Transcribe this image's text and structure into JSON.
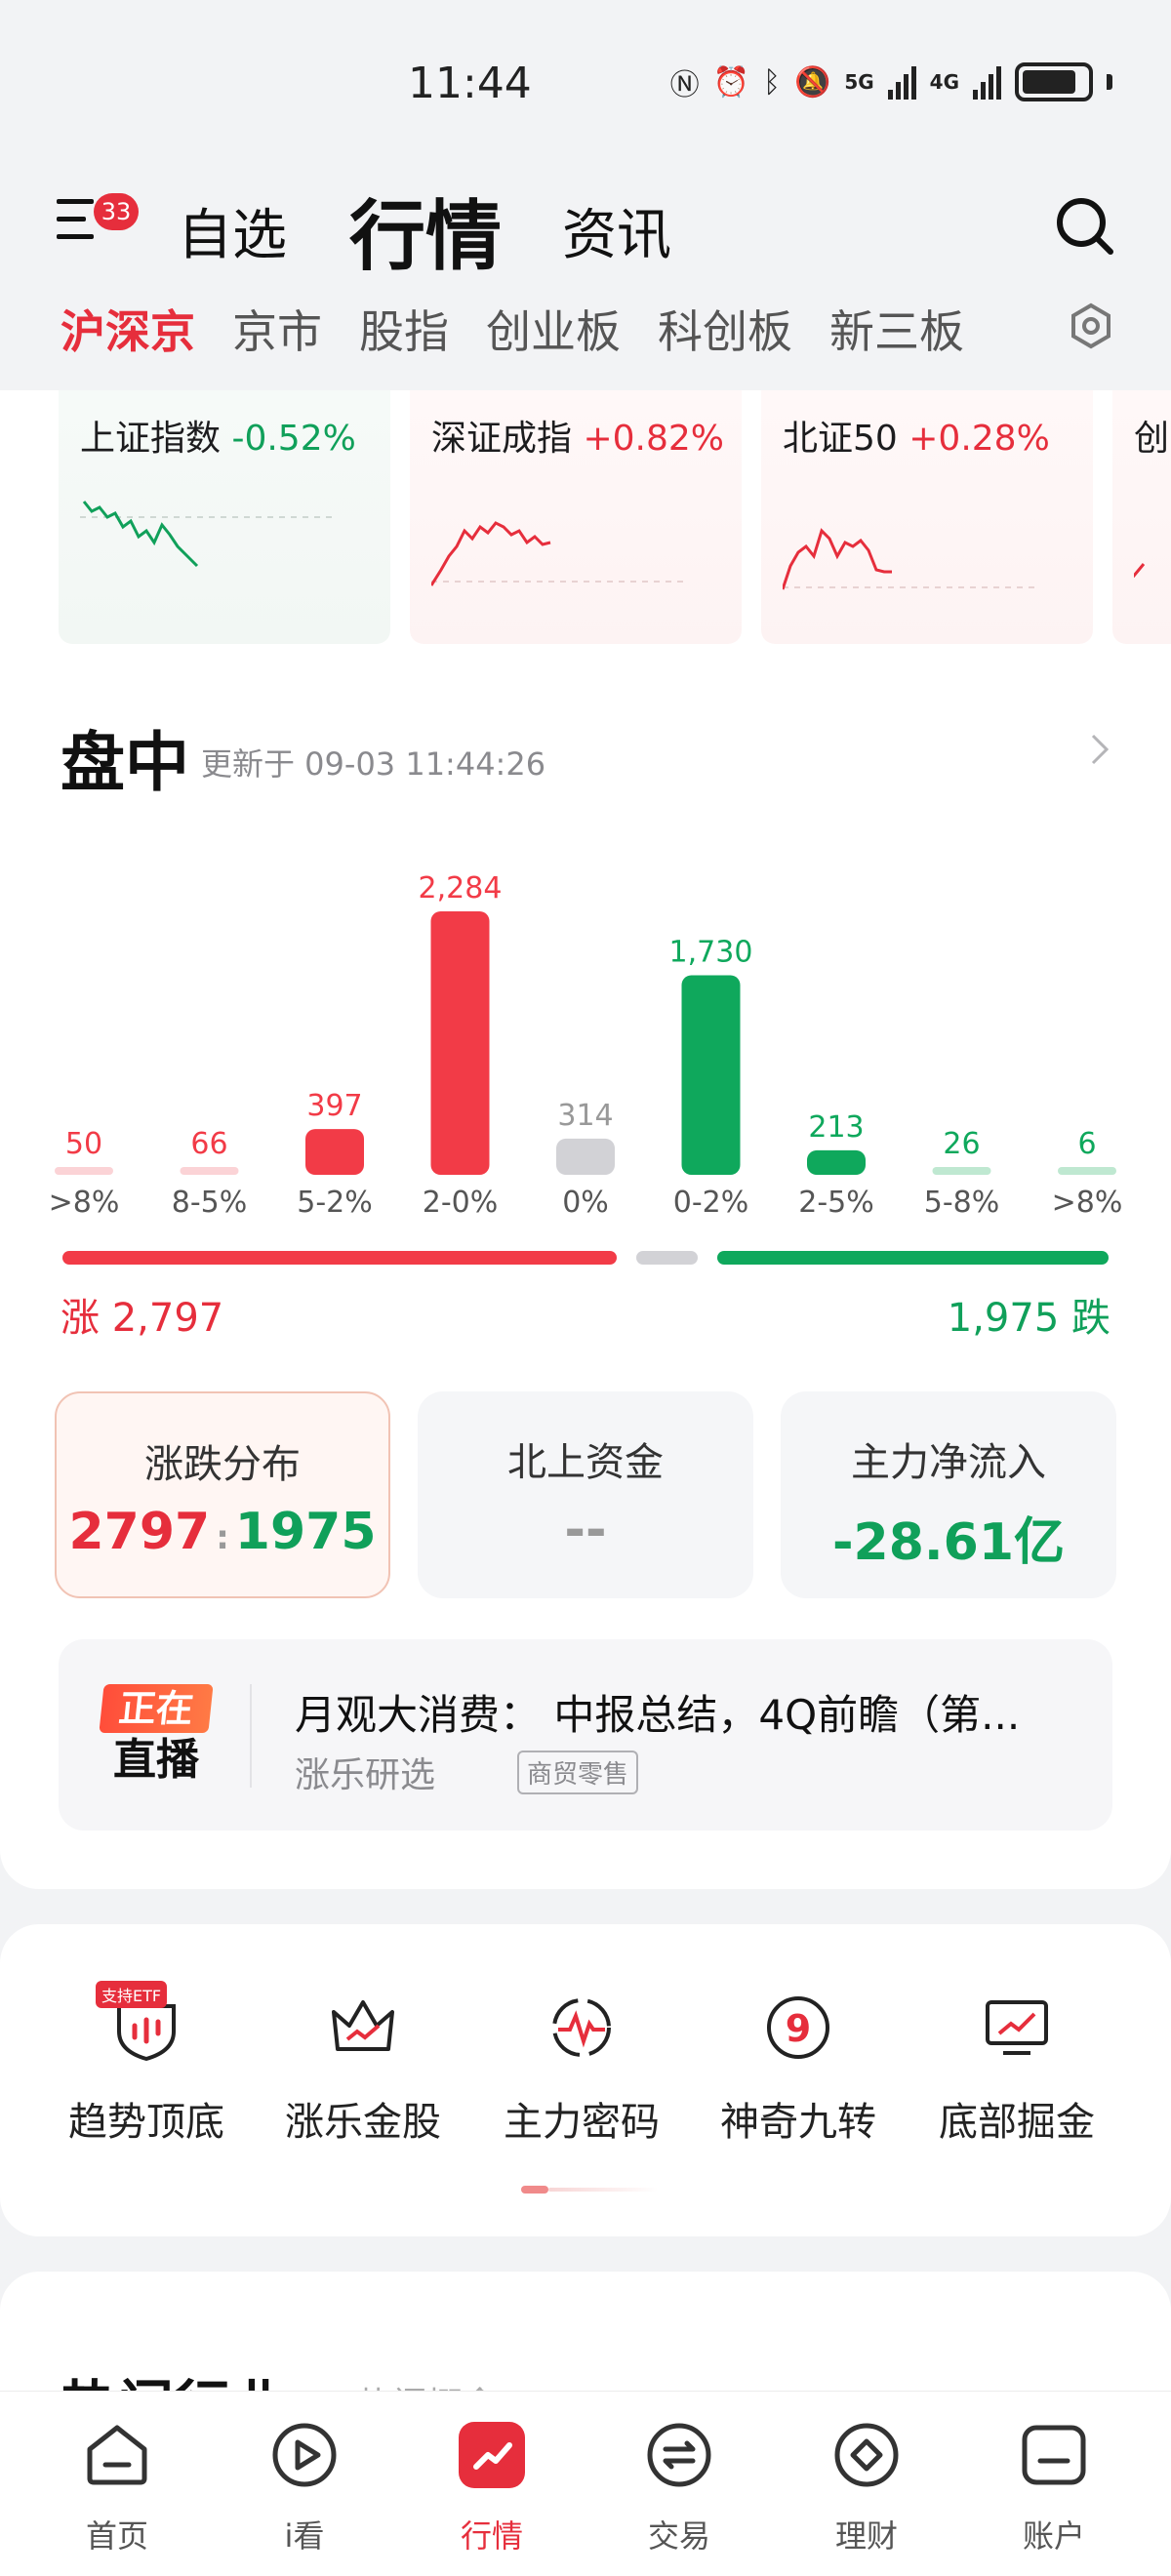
{
  "status": {
    "time": "11:44",
    "network_5g": "5G",
    "network_4g": "4G"
  },
  "header": {
    "menu_badge": "33",
    "tabs": [
      {
        "label": "自选",
        "active": false
      },
      {
        "label": "行情",
        "active": true
      },
      {
        "label": "资讯",
        "active": false
      }
    ]
  },
  "sub_tabs": [
    "沪深京",
    "京市",
    "股指",
    "创业板",
    "科创板",
    "新三板"
  ],
  "indices": [
    {
      "name": "上证指数",
      "change": "-0.52%",
      "direction": "down"
    },
    {
      "name": "深证成指",
      "change": "+0.82%",
      "direction": "up"
    },
    {
      "name": "北证50",
      "change": "+0.28%",
      "direction": "up"
    },
    {
      "name": "创",
      "change": "",
      "direction": "up"
    }
  ],
  "intraday": {
    "title": "盘中",
    "updated": "更新于 09-03 11:44:26"
  },
  "chart_data": {
    "type": "bar",
    "categories": [
      ">8%",
      "8-5%",
      "5-2%",
      "2-0%",
      "0%",
      "0-2%",
      "2-5%",
      "5-8%",
      ">8%"
    ],
    "values": [
      50,
      66,
      397,
      2284,
      314,
      1730,
      213,
      26,
      6
    ],
    "value_labels": [
      "50",
      "66",
      "397",
      "2,284",
      "314",
      "1,730",
      "213",
      "26",
      "6"
    ],
    "directions": [
      "up",
      "up",
      "up",
      "up",
      "flat",
      "down",
      "down",
      "down",
      "down"
    ],
    "title": "",
    "xlabel": "",
    "ylabel": "",
    "colors": {
      "up": "#f23b47",
      "flat": "#d2d2d6",
      "down": "#0fa85c"
    }
  },
  "totals": {
    "up_label": "涨 2,797",
    "down_label": "1,975 跌",
    "up": 2797,
    "flat": 314,
    "down": 1975
  },
  "stats": {
    "distribution": {
      "label": "涨跌分布",
      "up": "2797",
      "sep": ":",
      "down": "1975"
    },
    "northbound": {
      "label": "北上资金",
      "value": "--"
    },
    "main_flow": {
      "label": "主力净流入",
      "value": "-28.61亿"
    }
  },
  "live": {
    "logo_top": "正在",
    "logo_bottom": "直播",
    "title": "月观大消费： 中报总结，4Q前瞻（第...",
    "source": "涨乐研选",
    "tag": "商贸零售"
  },
  "tools": [
    {
      "label": "趋势顶底",
      "icon": "shield-trend-icon",
      "badge": "支持ETF"
    },
    {
      "label": "涨乐金股",
      "icon": "crown-icon"
    },
    {
      "label": "主力密码",
      "icon": "pulse-icon"
    },
    {
      "label": "神奇九转",
      "icon": "nine-icon"
    },
    {
      "label": "底部掘金",
      "icon": "monitor-chart-icon"
    }
  ],
  "hot": {
    "title": "热门行业",
    "sub": "热门概念"
  },
  "bottom_nav": [
    {
      "label": "首页",
      "icon": "home-icon"
    },
    {
      "label": "i看",
      "icon": "play-icon"
    },
    {
      "label": "行情",
      "icon": "market-icon",
      "active": true
    },
    {
      "label": "交易",
      "icon": "exchange-icon"
    },
    {
      "label": "理财",
      "icon": "diamond-icon"
    },
    {
      "label": "账户",
      "icon": "account-icon"
    }
  ]
}
